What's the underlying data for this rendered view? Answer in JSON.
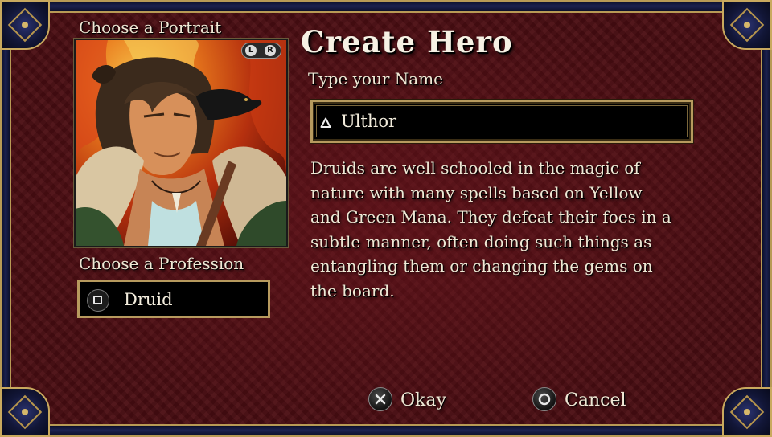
{
  "screen": {
    "title": "Create Hero"
  },
  "portrait": {
    "label": "Choose a Portrait",
    "prev_key": "L",
    "next_key": "R"
  },
  "name": {
    "label": "Type your Name",
    "value": "Ulthor",
    "icon": "triangle-icon"
  },
  "profession": {
    "label": "Choose a Profession",
    "value": "Druid",
    "icon": "square-icon"
  },
  "description": {
    "lines": [
      "Druids are well schooled in the magic of",
      "nature with many spells based on Yellow",
      "and Green Mana. They defeat their foes in a",
      "subtle manner, often doing such things as",
      "entangling them or changing the gems on",
      "the board."
    ]
  },
  "buttons": {
    "okay_label": "Okay",
    "okay_icon": "cross-icon",
    "cancel_label": "Cancel",
    "cancel_icon": "circle-icon"
  },
  "colors": {
    "background": "#4a0d12",
    "frame_gold": "#b79a5e",
    "border_navy": "#1c2250",
    "text": "#efe7d4"
  }
}
